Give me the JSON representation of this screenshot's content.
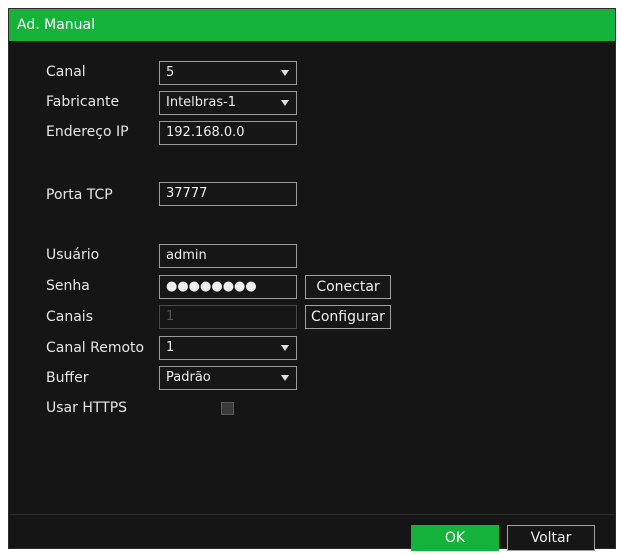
{
  "dialog": {
    "title": "Ad. Manual"
  },
  "form": {
    "canal": {
      "label": "Canal",
      "value": "5"
    },
    "fabricante": {
      "label": "Fabricante",
      "value": "Intelbras-1"
    },
    "endereco_ip": {
      "label": "Endereço IP",
      "value": "192.168.0.0"
    },
    "porta_tcp": {
      "label": "Porta TCP",
      "value": "37777"
    },
    "usuario": {
      "label": "Usuário",
      "value": "admin"
    },
    "senha": {
      "label": "Senha",
      "value": "●●●●●●●●"
    },
    "canais": {
      "label": "Canais",
      "value": "1"
    },
    "canal_remoto": {
      "label": "Canal Remoto",
      "value": "1"
    },
    "buffer": {
      "label": "Buffer",
      "value": "Padrão"
    },
    "usar_https": {
      "label": "Usar HTTPS",
      "checked": false
    }
  },
  "buttons": {
    "conectar": "Conectar",
    "configurar": "Configurar",
    "ok": "OK",
    "voltar": "Voltar"
  },
  "colors": {
    "accent": "#15b33b",
    "background": "#151515"
  },
  "icons": {
    "dropdown": "chevron-down-icon"
  }
}
